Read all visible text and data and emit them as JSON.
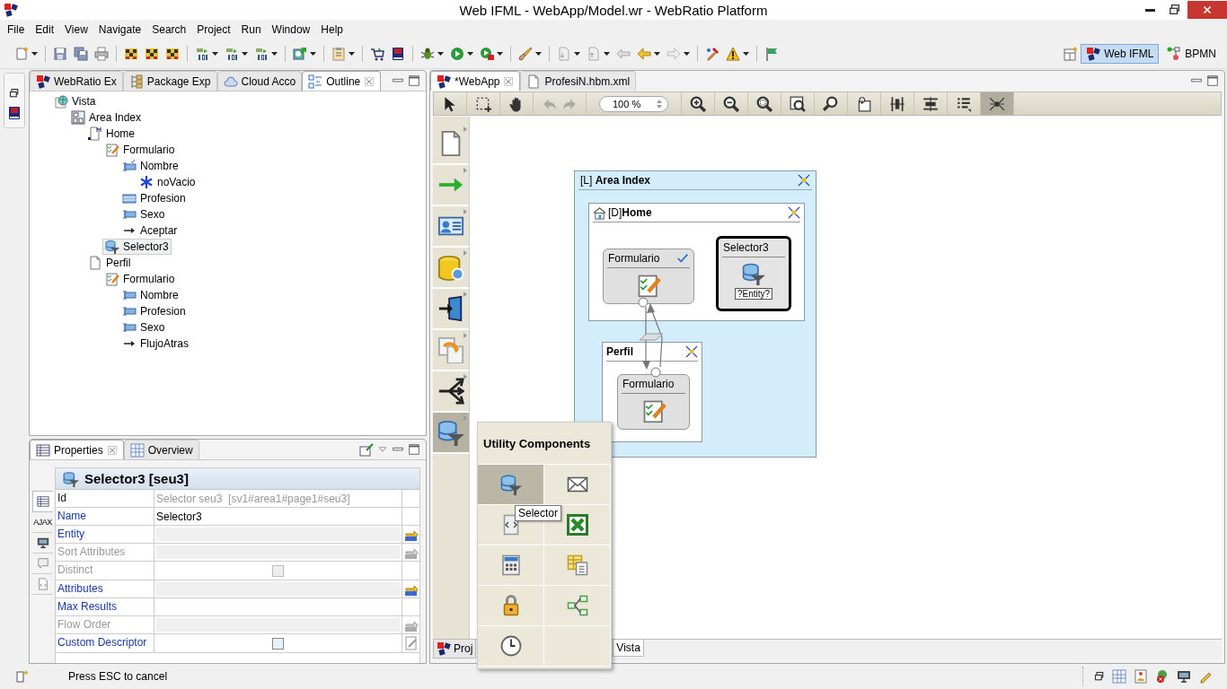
{
  "window": {
    "title": "Web IFML - WebApp/Model.wr - WebRatio Platform"
  },
  "menu": [
    "File",
    "Edit",
    "View",
    "Navigate",
    "Search",
    "Project",
    "Run",
    "Window",
    "Help"
  ],
  "perspectives": [
    {
      "label": "Web IFML",
      "selected": true
    },
    {
      "label": "BPMN",
      "selected": false
    }
  ],
  "left_tabs": [
    {
      "label": "WebRatio Ex",
      "kind": "logo",
      "selected": false
    },
    {
      "label": "Package Exp",
      "kind": "package",
      "selected": false
    },
    {
      "label": "Cloud Acco",
      "kind": "cloud",
      "selected": false
    },
    {
      "label": "Outline",
      "kind": "outline",
      "selected": true
    }
  ],
  "outline": [
    {
      "label": "Vista",
      "kind": "view",
      "selected": false,
      "children": [
        {
          "label": "Area Index",
          "kind": "area",
          "selected": false,
          "children": [
            {
              "label": "Home",
              "kind": "home-page",
              "selected": false,
              "children": [
                {
                  "label": "Formulario",
                  "kind": "form",
                  "selected": false,
                  "children": [
                    {
                      "label": "Nombre",
                      "kind": "checked-field",
                      "selected": false,
                      "children": [
                        {
                          "label": "noVacio",
                          "kind": "validation",
                          "selected": false
                        }
                      ]
                    },
                    {
                      "label": "Profesion",
                      "kind": "list-field",
                      "selected": false
                    },
                    {
                      "label": "Sexo",
                      "kind": "field",
                      "selected": false
                    },
                    {
                      "label": "Aceptar",
                      "kind": "flow",
                      "selected": false
                    }
                  ]
                },
                {
                  "label": "Selector3",
                  "kind": "selector",
                  "selected": true
                }
              ]
            },
            {
              "label": "Perfil",
              "kind": "page",
              "selected": false,
              "children": [
                {
                  "label": "Formulario",
                  "kind": "form",
                  "selected": false,
                  "children": [
                    {
                      "label": "Nombre",
                      "kind": "field",
                      "selected": false
                    },
                    {
                      "label": "Profesion",
                      "kind": "field",
                      "selected": false
                    },
                    {
                      "label": "Sexo",
                      "kind": "field",
                      "selected": false
                    },
                    {
                      "label": "FlujoAtras",
                      "kind": "flow",
                      "selected": false
                    }
                  ]
                }
              ]
            }
          ]
        }
      ]
    }
  ],
  "properties": {
    "tabs": [
      {
        "label": "Properties",
        "selected": true
      },
      {
        "label": "Overview",
        "selected": false
      }
    ],
    "side_tabs": [
      {
        "kind": "table",
        "selected": true
      },
      {
        "kind": "ajax",
        "label": "AJAX",
        "selected": false
      },
      {
        "kind": "monitor",
        "selected": false
      },
      {
        "kind": "comment",
        "selected": false
      },
      {
        "kind": "code",
        "selected": false
      }
    ],
    "title": "Selector3 [seu3]",
    "rows": [
      {
        "name": "Id",
        "kind": "readonly",
        "disabled": false,
        "value": "Selector seu3  [sv1#area1#page1#seu3]"
      },
      {
        "name": "Name",
        "kind": "text",
        "disabled": false,
        "value": "Selector3"
      },
      {
        "name": "Entity",
        "kind": "picker",
        "disabled": false
      },
      {
        "name": "Sort Attributes",
        "kind": "picker",
        "disabled": true
      },
      {
        "name": "Distinct",
        "kind": "checkbox",
        "disabled": true,
        "checked": false
      },
      {
        "name": "Attributes",
        "kind": "picker",
        "disabled": false
      },
      {
        "name": "Max Results",
        "kind": "text",
        "disabled": false
      },
      {
        "name": "Flow Order",
        "kind": "picker",
        "disabled": true
      },
      {
        "name": "Custom Descriptor",
        "kind": "checkbox",
        "disabled": false,
        "checked": false
      }
    ]
  },
  "editor": {
    "tabs": [
      {
        "label": "*WebApp",
        "selected": true
      },
      {
        "label": "ProfesiN.hbm.xml",
        "selected": false
      }
    ],
    "zoom": "100 %",
    "bottom_tabs": [
      {
        "label": "Proj",
        "selected": false
      },
      {
        "label": "Vista",
        "selected": true
      }
    ],
    "palette": [
      {
        "kind": "page",
        "selected": false
      },
      {
        "kind": "flow",
        "selected": false
      },
      {
        "kind": "form",
        "selected": false
      },
      {
        "kind": "entity",
        "selected": false
      },
      {
        "kind": "enter",
        "selected": false
      },
      {
        "kind": "jump",
        "selected": false
      },
      {
        "kind": "switch",
        "selected": false
      },
      {
        "kind": "selector",
        "selected": true
      }
    ],
    "popup": {
      "title": "Utility Components",
      "tooltip": "Selector",
      "items": [
        {
          "kind": "selector",
          "selected": true
        },
        {
          "kind": "mail",
          "selected": false
        },
        {
          "kind": "transform",
          "selected": false
        },
        {
          "kind": "excel",
          "selected": false
        },
        {
          "kind": "calculator",
          "selected": false
        },
        {
          "kind": "table",
          "selected": false
        },
        {
          "kind": "lock",
          "selected": false
        },
        {
          "kind": "tree",
          "selected": false
        },
        {
          "kind": "timer",
          "selected": false
        }
      ]
    }
  },
  "diagram": {
    "area": {
      "tag": "[L]",
      "title": "Area Index"
    },
    "pages": [
      {
        "tag": "[D]",
        "title": "Home",
        "home": true,
        "components": [
          {
            "kind": "form",
            "title": "Formulario",
            "valid": true,
            "selected": false
          },
          {
            "kind": "selector",
            "title": "Selector3",
            "badge": "?Entity?",
            "selected": true
          }
        ]
      },
      {
        "title": "Perfil",
        "home": false,
        "components": [
          {
            "kind": "form",
            "title": "Formulario",
            "valid": false,
            "selected": false
          }
        ]
      }
    ]
  },
  "status_bar": {
    "message": "Press ESC to cancel"
  }
}
